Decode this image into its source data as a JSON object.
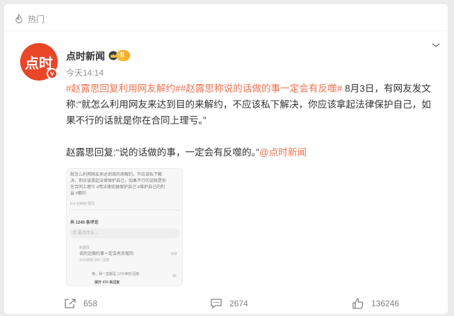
{
  "header": {
    "hot_label": "热门",
    "hot_icon": "fire-icon"
  },
  "author": {
    "avatar_text": "点时",
    "avatar_badge": "v",
    "name": "点时新闻",
    "level_badge": "II",
    "time": "今天14:14"
  },
  "post": {
    "para1_tag": "#赵露思回复利用网友解约##赵露思称说的话做的事一定会有反噬#",
    "para1_text": " 8月3日，有网友发文称:“就怎么利用网友来达到目的来解约，不应该私下解决，你应该拿起法律保护自己，如果不行的话就是你在合同上理亏。”",
    "para2_text": "赵露思回复:“说的话做的事，一定会有反噬的。”",
    "para2_mention": "@点时新闻"
  },
  "thumbnail": {
    "line1": "就怎么利用网友来达到目的来解约，不应该私下解",
    "line2": "决，你应该拿起法律保护自己，如果不行的话就是你",
    "line3": "在合同上理亏 #用法律武器保护自己 #维护自己的利",
    "line4": "益 #解约",
    "meta": "8-3 分钟前 赞同",
    "comments_title": "共 1240 条评论",
    "comment_placeholder": "点 说点什么...",
    "c1_user": "赵露思",
    "c1_text": "说的话做的事一定会有反噬的",
    "c1_meta": "10分钟前 四川 回复",
    "c1_likes": "608",
    "c2_text": "哦，我一直都是 12分钟前 回复",
    "c2_likes": "40",
    "c3_text": "展开 476 条回复"
  },
  "actions": {
    "share_count": "658",
    "comment_count": "2674",
    "like_count": "136246"
  },
  "colors": {
    "accent": "#eb7350",
    "avatar_bg": "#e94527",
    "muted": "#939393"
  }
}
